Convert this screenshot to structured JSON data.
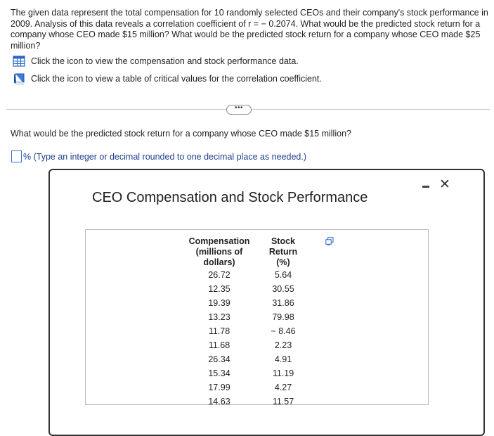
{
  "intro": {
    "text": "The given data represent the total compensation for 10 randomly selected CEOs and their company's stock performance in 2009. Analysis of this data reveals a correlation coefficient of r = − 0.2074. What would be the predicted stock return for a company whose CEO made $15 million? What would be the predicted stock return for a company whose CEO made $25 million?"
  },
  "tools": {
    "data_link_text": "Click the icon to view the compensation and stock performance data.",
    "critical_link_text": "Click the icon to view a table of critical values for the correlation coefficient."
  },
  "divider": {
    "more_label": "•••"
  },
  "question": {
    "text": "What would be the predicted stock return for a company whose CEO made $15 million?",
    "answer_suffix": "% (Type an integer or decimal rounded to one decimal place as needed.)"
  },
  "popup": {
    "title": "CEO Compensation and Stock Performance",
    "minimize_label": "−",
    "close_label": "✕",
    "table": {
      "headers": [
        {
          "line1": "Compensation",
          "line2": "(millions of dollars)"
        },
        {
          "line1": "Stock",
          "line2": "Return (%)"
        }
      ],
      "rows": [
        [
          "26.72",
          "5.64"
        ],
        [
          "12.35",
          "30.55"
        ],
        [
          "19.39",
          "31.86"
        ],
        [
          "13.23",
          "79.98"
        ],
        [
          "11.78",
          "− 8.46"
        ],
        [
          "11.68",
          "2.23"
        ],
        [
          "26.34",
          "4.91"
        ],
        [
          "15.34",
          "11.19"
        ],
        [
          "17.99",
          "4.27"
        ],
        [
          "14.63",
          "11.57"
        ]
      ]
    }
  },
  "colors": {
    "link_blue": "#1f3f8f",
    "answer_box_border": "#3a6fcf",
    "table_border": "#b8b8b8"
  }
}
